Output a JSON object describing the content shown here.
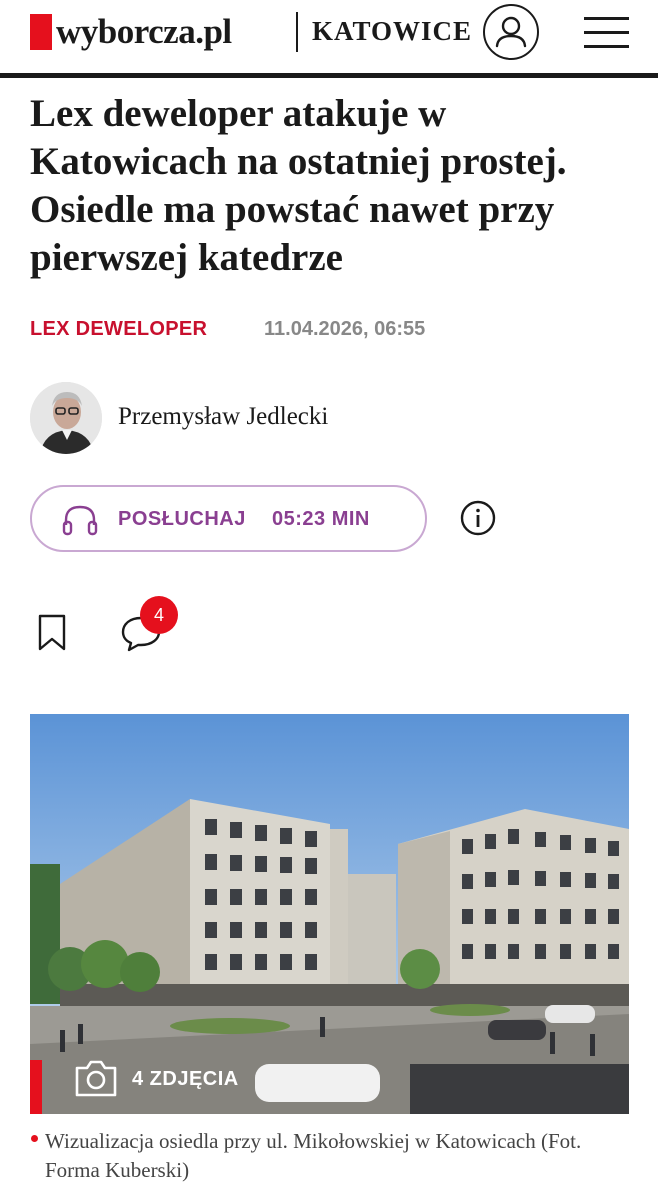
{
  "header": {
    "logo_text": "wyborcza.pl",
    "section": "KATOWICE",
    "brand_color": "#e5101d",
    "account_icon": "user-icon",
    "menu_icon": "hamburger-menu-icon"
  },
  "article": {
    "title": "Lex deweloper atakuje w Katowicach na ostatniej prostej. Osiedle ma powstać nawet przy pierwszej katedrze",
    "tag": "LEX DEWELOPER",
    "date": "11.04.2026, 06:55",
    "author": {
      "name": "Przemysław Jedlecki"
    },
    "listen": {
      "label": "POSŁUCHAJ",
      "duration": "05:23 MIN",
      "icon": "headphones-icon",
      "color": "#8a3f91"
    },
    "info_icon": "info-icon",
    "actions": {
      "bookmark_icon": "bookmark-icon",
      "comment_icon": "comment-icon",
      "comment_count": "4"
    },
    "image": {
      "gallery_label": "4 ZDJĘCIA",
      "gallery_icon": "camera-icon",
      "caption": "Wizualizacja osiedla przy ul. Mikołowskiej w Katowicach (Fot. Forma Kuberski)"
    }
  }
}
